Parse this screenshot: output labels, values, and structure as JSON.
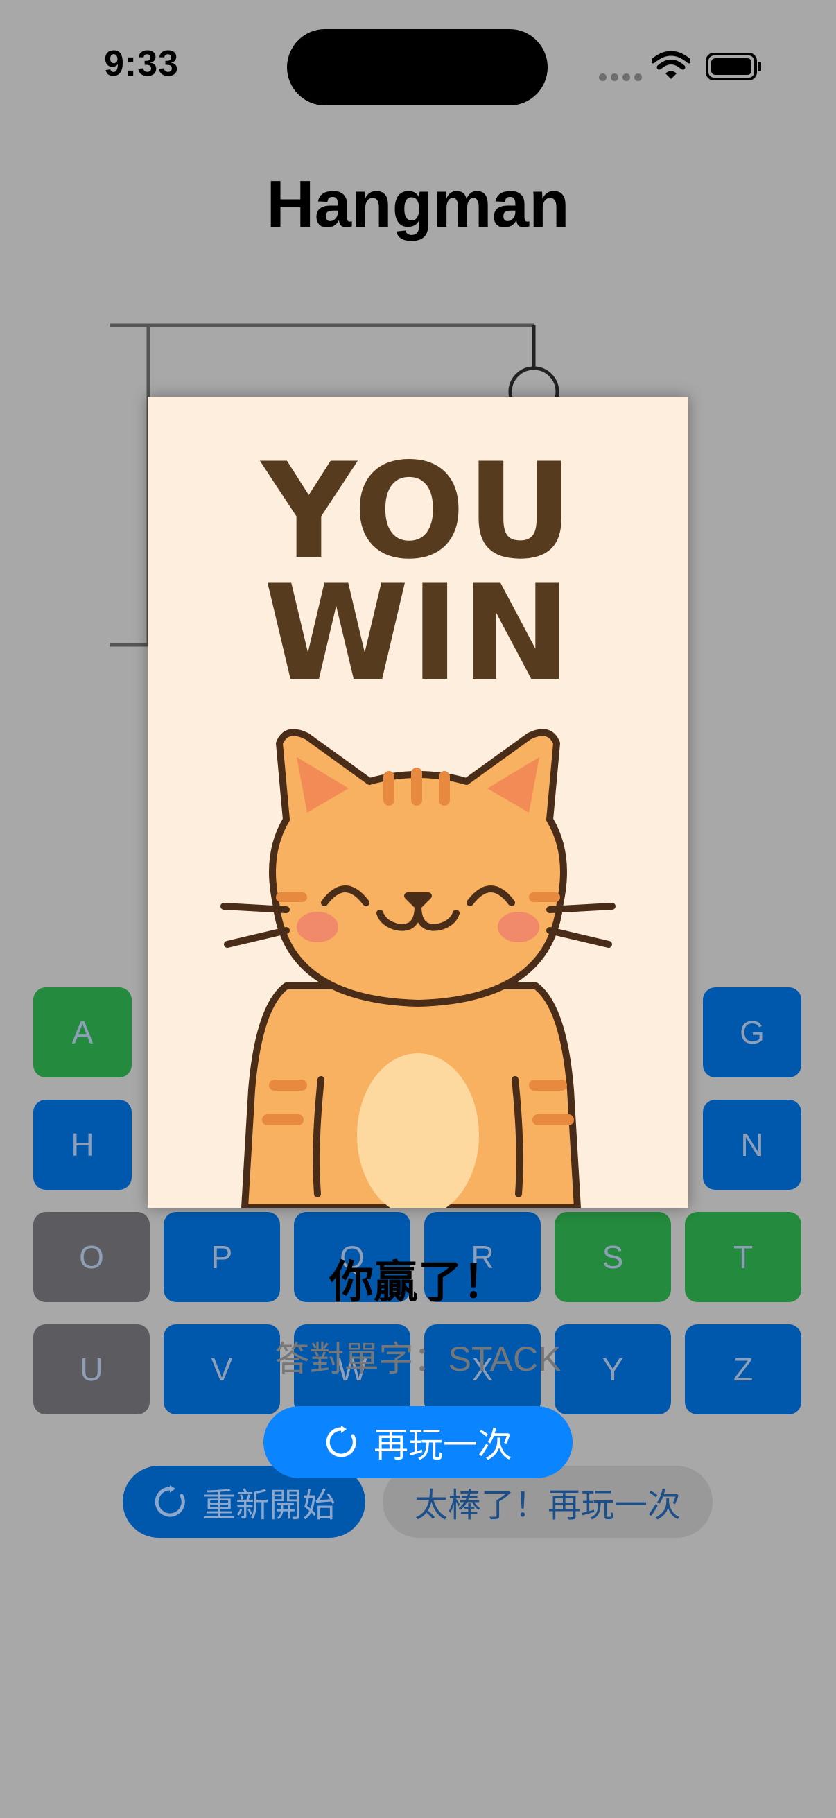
{
  "status_bar": {
    "time": "9:33"
  },
  "app": {
    "title": "Hangman"
  },
  "keyboard": {
    "rows": [
      [
        {
          "letter": "A",
          "state": "green"
        },
        {
          "letter": "G",
          "state": "blue"
        }
      ],
      [
        {
          "letter": "H",
          "state": "blue"
        },
        {
          "letter": "N",
          "state": "blue"
        }
      ],
      [
        {
          "letter": "O",
          "state": "gray"
        },
        {
          "letter": "P",
          "state": "blue"
        },
        {
          "letter": "Q",
          "state": "blue"
        },
        {
          "letter": "R",
          "state": "blue"
        },
        {
          "letter": "S",
          "state": "green"
        },
        {
          "letter": "T",
          "state": "green"
        }
      ],
      [
        {
          "letter": "U",
          "state": "gray"
        },
        {
          "letter": "V",
          "state": "blue"
        },
        {
          "letter": "W",
          "state": "blue"
        },
        {
          "letter": "X",
          "state": "blue"
        },
        {
          "letter": "Y",
          "state": "blue"
        },
        {
          "letter": "Z",
          "state": "blue"
        }
      ]
    ]
  },
  "buttons": {
    "restart": "重新開始",
    "great": "太棒了！再玩一次"
  },
  "result_modal": {
    "image_text_line1": "YOU",
    "image_text_line2": "WIN",
    "message": "你贏了！",
    "answer_line": "答對單字：STACK",
    "play_again": "再玩一次"
  },
  "colors": {
    "key_blue": "#0058ad",
    "key_green": "#248a3d",
    "key_gray": "#5c5c60",
    "accent": "#0a84ff",
    "card_bg": "#fdeede",
    "win_text": "#573b1f"
  }
}
